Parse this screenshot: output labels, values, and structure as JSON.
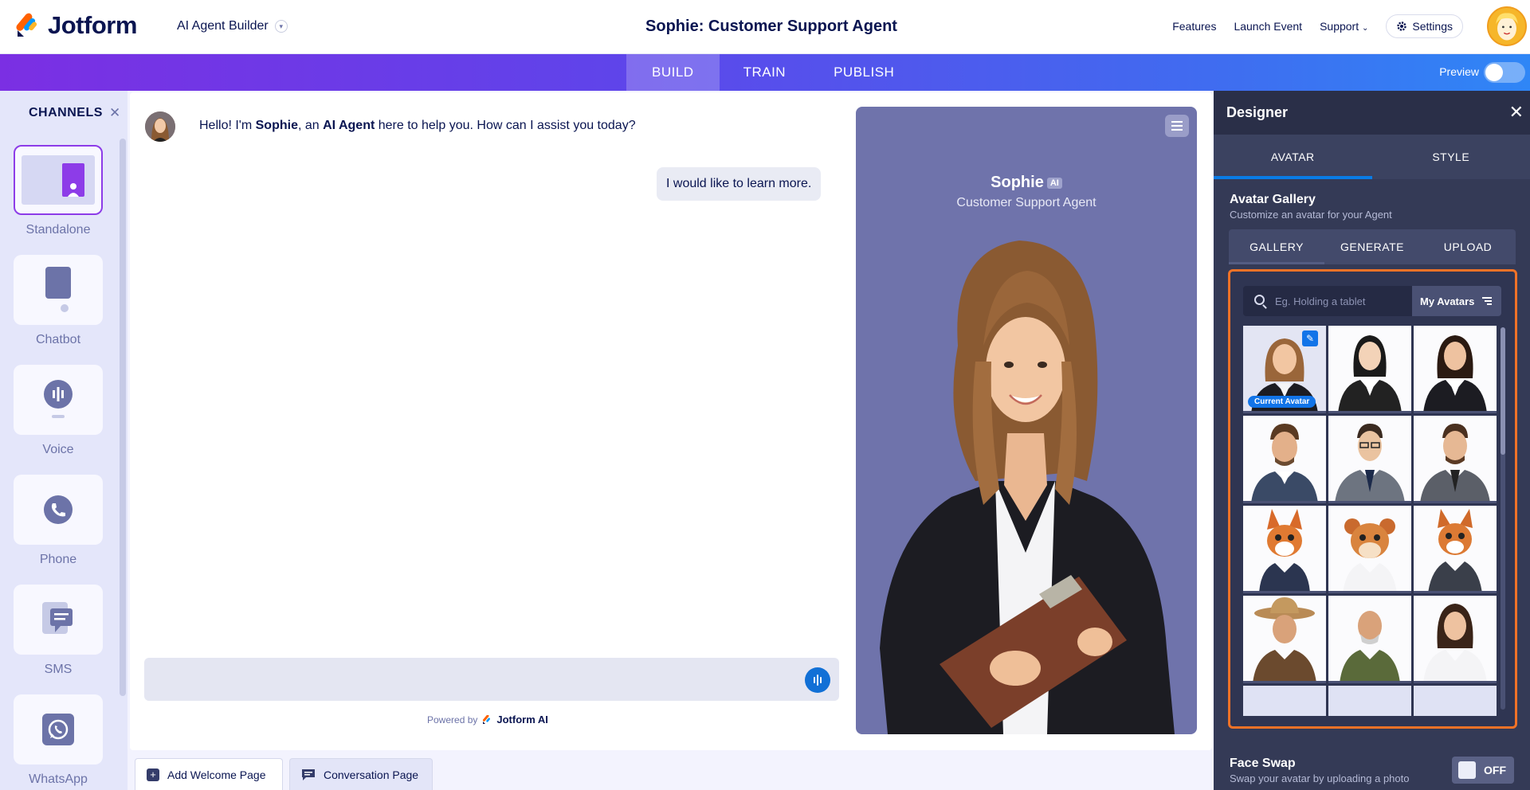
{
  "header": {
    "logo_text": "Jotform",
    "product": "AI Agent Builder",
    "agent_title": "Sophie: Customer Support Agent",
    "links": [
      "Features",
      "Launch Event",
      "Support"
    ],
    "settings_label": "Settings"
  },
  "nav": {
    "tabs": [
      "BUILD",
      "TRAIN",
      "PUBLISH"
    ],
    "active_tab": "BUILD",
    "preview_label": "Preview"
  },
  "channels": {
    "title": "CHANNELS",
    "items": [
      {
        "label": "Standalone",
        "icon": "standalone-icon",
        "selected": true
      },
      {
        "label": "Chatbot",
        "icon": "chatbot-icon",
        "selected": false
      },
      {
        "label": "Voice",
        "icon": "voice-icon",
        "selected": false
      },
      {
        "label": "Phone",
        "icon": "phone-icon",
        "selected": false
      },
      {
        "label": "SMS",
        "icon": "sms-icon",
        "selected": false
      },
      {
        "label": "WhatsApp",
        "icon": "whatsapp-icon",
        "selected": false
      }
    ]
  },
  "chat": {
    "bot_msg_pre": "Hello! I'm ",
    "bot_name": "Sophie",
    "bot_msg_mid": ", an ",
    "bot_role": "AI Agent",
    "bot_msg_post": " here to help you. How can I assist you today?",
    "user_msg": "I would like to learn more.",
    "powered_by": "Powered by",
    "powered_brand": "Jotform AI"
  },
  "agent_card": {
    "name": "Sophie",
    "ai_badge": "AI",
    "role": "Customer Support Agent"
  },
  "pages": {
    "add_welcome": "Add Welcome Page",
    "conversation": "Conversation Page"
  },
  "designer": {
    "title": "Designer",
    "tabs": [
      "AVATAR",
      "STYLE"
    ],
    "active_tab": "AVATAR",
    "gallery_title": "Avatar Gallery",
    "gallery_sub": "Customize an avatar for your Agent",
    "sub_tabs": [
      "GALLERY",
      "GENERATE",
      "UPLOAD"
    ],
    "search_placeholder": "Eg. Holding a tablet",
    "my_avatars": "My Avatars",
    "current_avatar": "Current Avatar",
    "face_swap_title": "Face Swap",
    "face_swap_sub": "Swap your avatar by uploading a photo",
    "face_swap_state": "OFF"
  },
  "colors": {
    "brand_dark": "#0a1551",
    "accent_blue": "#1274e8",
    "highlight_orange": "#f07227",
    "card_purple": "#6f73ab"
  }
}
